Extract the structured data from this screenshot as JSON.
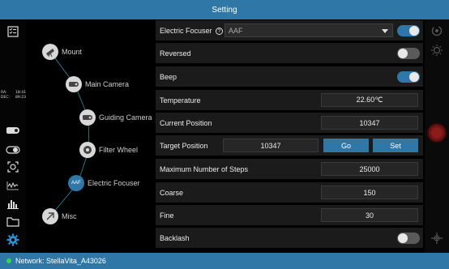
{
  "window": {
    "title": "Setting"
  },
  "coords": {
    "ra_label": "RA:",
    "ra_value": "18:41",
    "dec_label": "DEC:",
    "dec_value": "89:23"
  },
  "sidebar": {
    "icons": [
      "checklist-icon",
      "camera-icon",
      "toggle-icon",
      "focus-frame-icon",
      "waveform-icon",
      "histogram-icon",
      "folder-icon",
      "gear-icon"
    ]
  },
  "tree": {
    "nodes": [
      {
        "label": "Mount"
      },
      {
        "label": "Main Camera"
      },
      {
        "label": "Guiding Camera"
      },
      {
        "label": "Filter Wheel"
      },
      {
        "label": "Electric Focuser"
      },
      {
        "label": "Misc"
      }
    ],
    "focuser_badge": "AAF"
  },
  "settings": {
    "focuser": {
      "label": "Electric Focuser",
      "select_value": "AAF",
      "enabled": true
    },
    "reversed": {
      "label": "Reversed",
      "enabled": false
    },
    "beep": {
      "label": "Beep",
      "enabled": true
    },
    "temperature": {
      "label": "Temperature",
      "value": "22.60℃"
    },
    "current_position": {
      "label": "Current Position",
      "value": "10347"
    },
    "target_position": {
      "label": "Target Position",
      "value": "10347",
      "go_label": "Go",
      "set_label": "Set"
    },
    "max_steps": {
      "label": "Maximum Number of Steps",
      "value": "25000"
    },
    "coarse": {
      "label": "Coarse",
      "value": "150"
    },
    "fine": {
      "label": "Fine",
      "value": "30"
    },
    "backlash": {
      "label": "Backlash",
      "enabled": false
    }
  },
  "status": {
    "network": "Network: StellaVita_A43026"
  },
  "colors": {
    "accent": "#2f77a6",
    "toggle_off": "#5a5a5a",
    "row_bg": "#1b1b1b",
    "status_dot": "#39d353",
    "capture": "#6a1414"
  }
}
